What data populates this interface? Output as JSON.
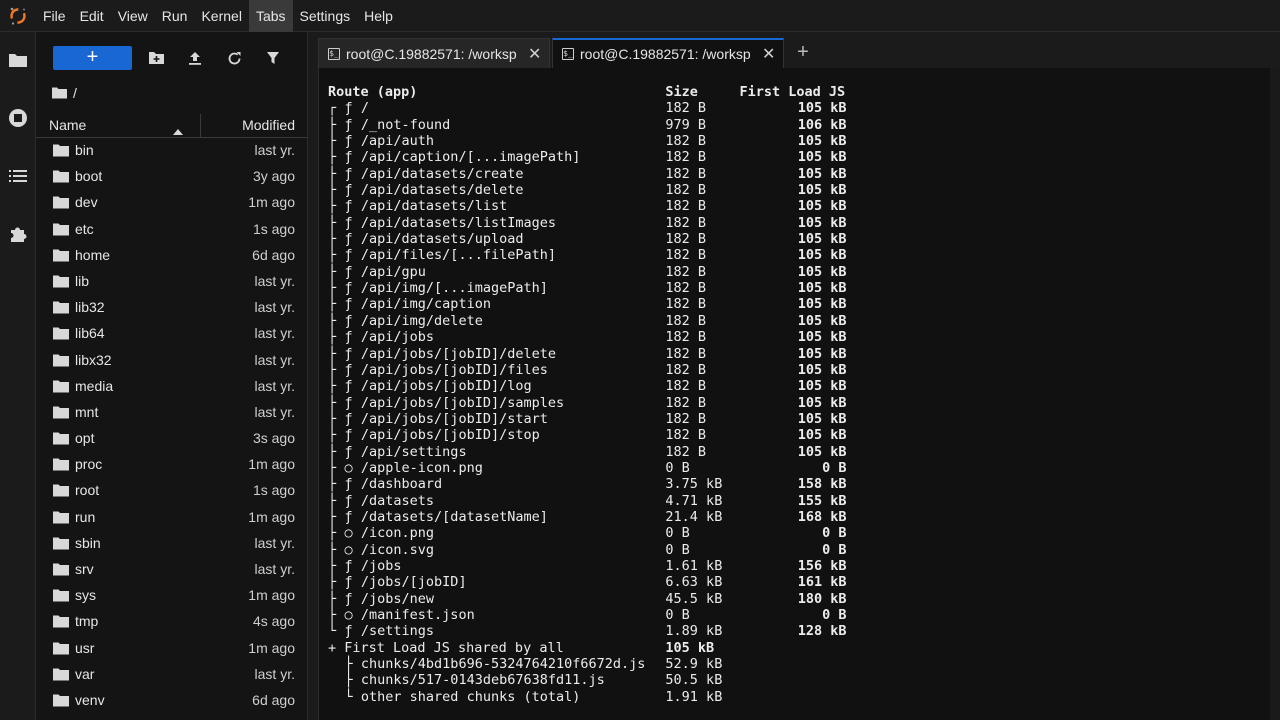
{
  "menu": [
    "File",
    "Edit",
    "View",
    "Run",
    "Kernel",
    "Tabs",
    "Settings",
    "Help"
  ],
  "menu_active": "Tabs",
  "filebrowser": {
    "new_button": "+",
    "breadcrumb": "/",
    "header": {
      "name": "Name",
      "modified": "Modified"
    },
    "rows": [
      {
        "name": "bin",
        "modified": "last yr."
      },
      {
        "name": "boot",
        "modified": "3y ago"
      },
      {
        "name": "dev",
        "modified": "1m ago"
      },
      {
        "name": "etc",
        "modified": "1s ago"
      },
      {
        "name": "home",
        "modified": "6d ago"
      },
      {
        "name": "lib",
        "modified": "last yr."
      },
      {
        "name": "lib32",
        "modified": "last yr."
      },
      {
        "name": "lib64",
        "modified": "last yr."
      },
      {
        "name": "libx32",
        "modified": "last yr."
      },
      {
        "name": "media",
        "modified": "last yr."
      },
      {
        "name": "mnt",
        "modified": "last yr."
      },
      {
        "name": "opt",
        "modified": "3s ago"
      },
      {
        "name": "proc",
        "modified": "1m ago"
      },
      {
        "name": "root",
        "modified": "1s ago"
      },
      {
        "name": "run",
        "modified": "1m ago"
      },
      {
        "name": "sbin",
        "modified": "last yr."
      },
      {
        "name": "srv",
        "modified": "last yr."
      },
      {
        "name": "sys",
        "modified": "1m ago"
      },
      {
        "name": "tmp",
        "modified": "4s ago"
      },
      {
        "name": "usr",
        "modified": "1m ago"
      },
      {
        "name": "var",
        "modified": "last yr."
      },
      {
        "name": "venv",
        "modified": "6d ago"
      }
    ]
  },
  "tabs": [
    {
      "label": "root@C.19882571: /worksp",
      "active": false,
      "icon": "$_"
    },
    {
      "label": "root@C.19882571: /worksp",
      "active": true,
      "icon": "$_"
    }
  ],
  "add_tab": "+",
  "terminal": {
    "header": {
      "route": "Route (app)",
      "size": "Size",
      "first": "First Load JS"
    },
    "routes": [
      {
        "tree": "┌",
        "sym": "ƒ",
        "path": "/",
        "size": "182 B",
        "first": "105 kB"
      },
      {
        "tree": "├",
        "sym": "ƒ",
        "path": "/_not-found",
        "size": "979 B",
        "first": "106 kB"
      },
      {
        "tree": "├",
        "sym": "ƒ",
        "path": "/api/auth",
        "size": "182 B",
        "first": "105 kB"
      },
      {
        "tree": "├",
        "sym": "ƒ",
        "path": "/api/caption/[...imagePath]",
        "size": "182 B",
        "first": "105 kB"
      },
      {
        "tree": "├",
        "sym": "ƒ",
        "path": "/api/datasets/create",
        "size": "182 B",
        "first": "105 kB"
      },
      {
        "tree": "├",
        "sym": "ƒ",
        "path": "/api/datasets/delete",
        "size": "182 B",
        "first": "105 kB"
      },
      {
        "tree": "├",
        "sym": "ƒ",
        "path": "/api/datasets/list",
        "size": "182 B",
        "first": "105 kB"
      },
      {
        "tree": "├",
        "sym": "ƒ",
        "path": "/api/datasets/listImages",
        "size": "182 B",
        "first": "105 kB"
      },
      {
        "tree": "├",
        "sym": "ƒ",
        "path": "/api/datasets/upload",
        "size": "182 B",
        "first": "105 kB"
      },
      {
        "tree": "├",
        "sym": "ƒ",
        "path": "/api/files/[...filePath]",
        "size": "182 B",
        "first": "105 kB"
      },
      {
        "tree": "├",
        "sym": "ƒ",
        "path": "/api/gpu",
        "size": "182 B",
        "first": "105 kB"
      },
      {
        "tree": "├",
        "sym": "ƒ",
        "path": "/api/img/[...imagePath]",
        "size": "182 B",
        "first": "105 kB"
      },
      {
        "tree": "├",
        "sym": "ƒ",
        "path": "/api/img/caption",
        "size": "182 B",
        "first": "105 kB"
      },
      {
        "tree": "├",
        "sym": "ƒ",
        "path": "/api/img/delete",
        "size": "182 B",
        "first": "105 kB"
      },
      {
        "tree": "├",
        "sym": "ƒ",
        "path": "/api/jobs",
        "size": "182 B",
        "first": "105 kB"
      },
      {
        "tree": "├",
        "sym": "ƒ",
        "path": "/api/jobs/[jobID]/delete",
        "size": "182 B",
        "first": "105 kB"
      },
      {
        "tree": "├",
        "sym": "ƒ",
        "path": "/api/jobs/[jobID]/files",
        "size": "182 B",
        "first": "105 kB"
      },
      {
        "tree": "├",
        "sym": "ƒ",
        "path": "/api/jobs/[jobID]/log",
        "size": "182 B",
        "first": "105 kB"
      },
      {
        "tree": "├",
        "sym": "ƒ",
        "path": "/api/jobs/[jobID]/samples",
        "size": "182 B",
        "first": "105 kB"
      },
      {
        "tree": "├",
        "sym": "ƒ",
        "path": "/api/jobs/[jobID]/start",
        "size": "182 B",
        "first": "105 kB"
      },
      {
        "tree": "├",
        "sym": "ƒ",
        "path": "/api/jobs/[jobID]/stop",
        "size": "182 B",
        "first": "105 kB"
      },
      {
        "tree": "├",
        "sym": "ƒ",
        "path": "/api/settings",
        "size": "182 B",
        "first": "105 kB"
      },
      {
        "tree": "├",
        "sym": "○",
        "path": "/apple-icon.png",
        "size": "0 B",
        "first": "0 B"
      },
      {
        "tree": "├",
        "sym": "ƒ",
        "path": "/dashboard",
        "size": "3.75 kB",
        "first": "158 kB"
      },
      {
        "tree": "├",
        "sym": "ƒ",
        "path": "/datasets",
        "size": "4.71 kB",
        "first": "155 kB"
      },
      {
        "tree": "├",
        "sym": "ƒ",
        "path": "/datasets/[datasetName]",
        "size": "21.4 kB",
        "first": "168 kB"
      },
      {
        "tree": "├",
        "sym": "○",
        "path": "/icon.png",
        "size": "0 B",
        "first": "0 B"
      },
      {
        "tree": "├",
        "sym": "○",
        "path": "/icon.svg",
        "size": "0 B",
        "first": "0 B"
      },
      {
        "tree": "├",
        "sym": "ƒ",
        "path": "/jobs",
        "size": "1.61 kB",
        "first": "156 kB"
      },
      {
        "tree": "├",
        "sym": "ƒ",
        "path": "/jobs/[jobID]",
        "size": "6.63 kB",
        "first": "161 kB"
      },
      {
        "tree": "├",
        "sym": "ƒ",
        "path": "/jobs/new",
        "size": "45.5 kB",
        "first": "180 kB"
      },
      {
        "tree": "├",
        "sym": "○",
        "path": "/manifest.json",
        "size": "0 B",
        "first": "0 B"
      },
      {
        "tree": "└",
        "sym": "ƒ",
        "path": "/settings",
        "size": "1.89 kB",
        "first": "128 kB"
      }
    ],
    "shared": {
      "label": "+ First Load JS shared by all",
      "first": "105 kB"
    },
    "chunks": [
      {
        "tree": "├",
        "name": "chunks/4bd1b696-5324764210f6672d.js",
        "size": "52.9 kB"
      },
      {
        "tree": "├",
        "name": "chunks/517-0143deb67638fd11.js",
        "size": "50.5 kB"
      },
      {
        "tree": "└",
        "name": "other shared chunks (total)",
        "size": "1.91 kB"
      }
    ]
  }
}
